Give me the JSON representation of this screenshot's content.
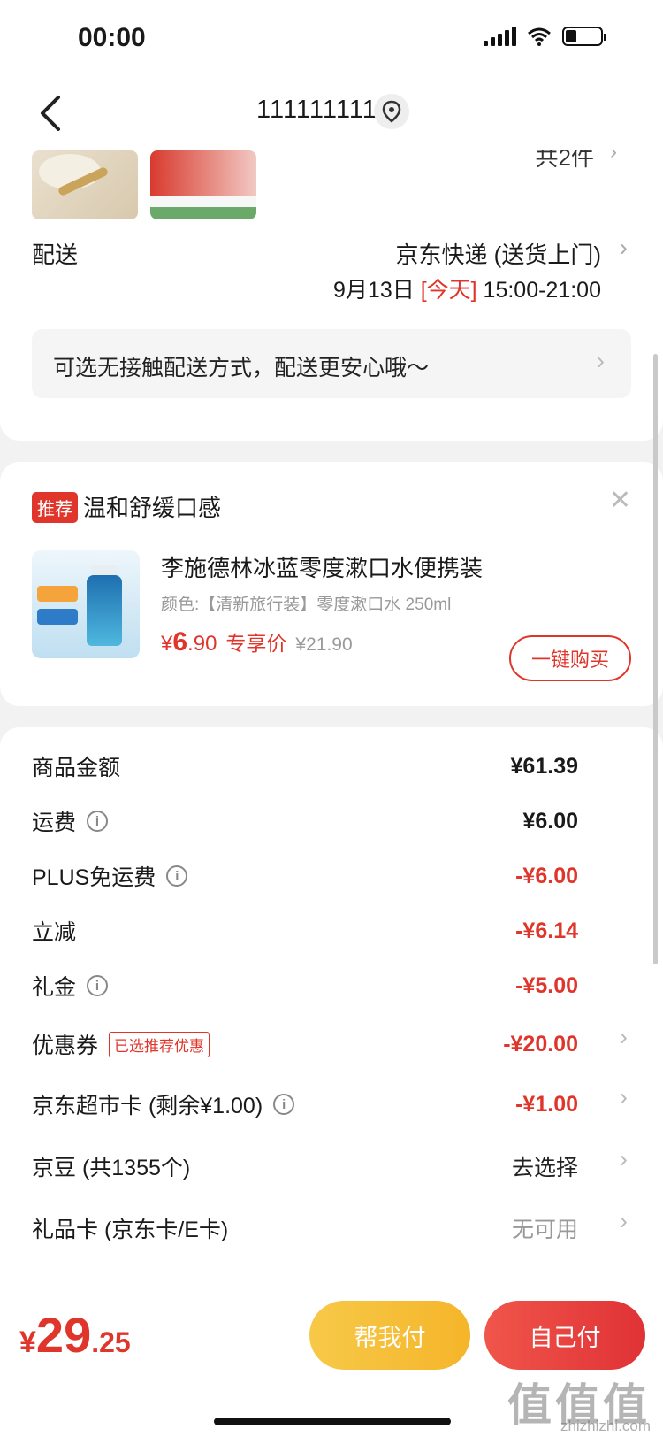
{
  "status_bar": {
    "time": "00:00"
  },
  "nav": {
    "title": "111111111"
  },
  "order_summary": {
    "item_count": "共2件"
  },
  "delivery": {
    "label": "配送",
    "method": "京东快递 (送货上门)",
    "date": "9月13日",
    "today": "[今天]",
    "time_range": "15:00-21:00",
    "contactless_text": "可选无接触配送方式，配送更安心哦～"
  },
  "recommend": {
    "tag": "推荐",
    "title": "温和舒缓口感",
    "product_name": "李施德林冰蓝零度漱口水便携装",
    "product_spec": "颜色:【清新旅行装】零度漱口水 250ml",
    "price_currency": "¥",
    "price_int": "6",
    "price_dec": ".90",
    "price_label": "专享价",
    "price_orig": "¥21.90",
    "buy_label": "一键购买"
  },
  "fees": [
    {
      "label": "商品金额",
      "value": "¥61.39"
    },
    {
      "label": "运费",
      "value": "¥6.00"
    },
    {
      "label": "PLUS免运费",
      "value": "-¥6.00"
    },
    {
      "label": "立减",
      "value": "-¥6.14"
    },
    {
      "label": "礼金",
      "value": "-¥5.00"
    },
    {
      "label": "优惠券",
      "tag": "已选推荐优惠",
      "value": "-¥20.00"
    },
    {
      "label": "京东超市卡 (剩余¥1.00)",
      "value": "-¥1.00"
    },
    {
      "label": "京豆 (共1355个)",
      "value": "去选择"
    },
    {
      "label": "礼品卡 (京东卡/E卡)",
      "value": "无可用"
    }
  ],
  "footer": {
    "currency": "¥",
    "total_int": "29",
    "total_dec": ".25",
    "help_pay": "帮我付",
    "self_pay": "自己付",
    "watermark": "值值值",
    "watermark_url": "zhizhizhi.com"
  },
  "colors": {
    "accent": "#e0352b",
    "yellow": "#f5b52a"
  }
}
